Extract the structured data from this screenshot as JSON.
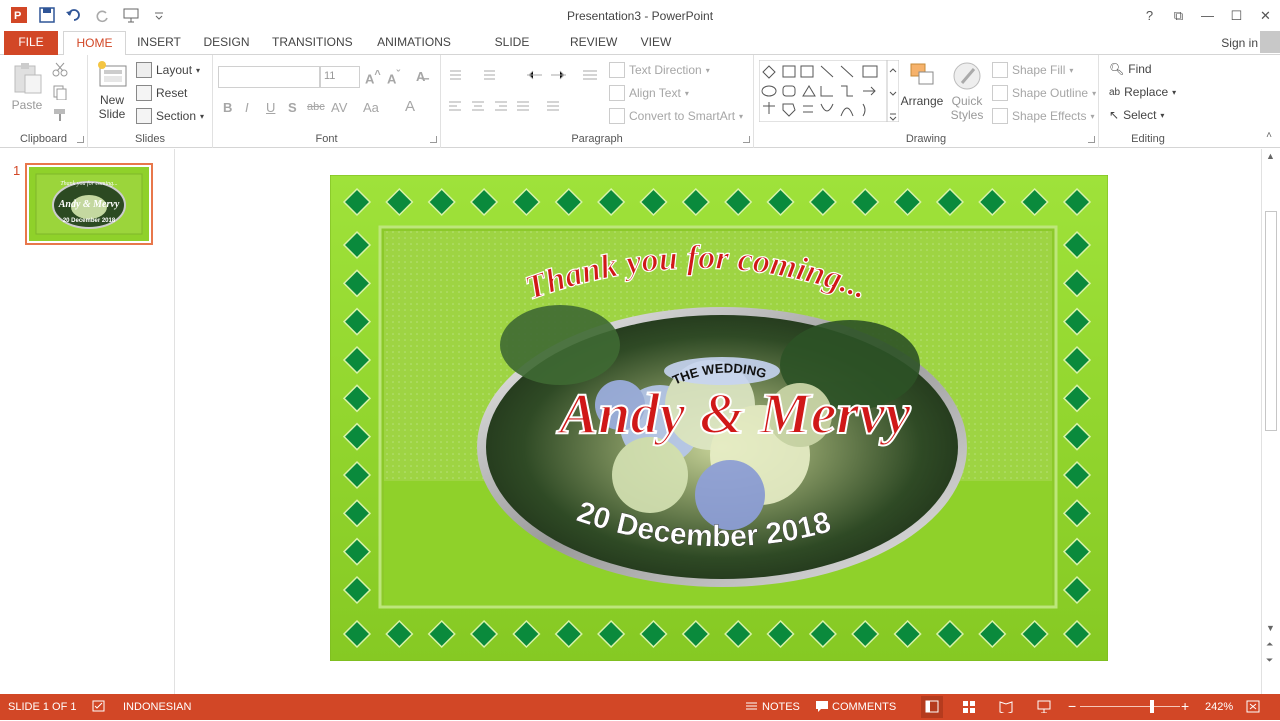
{
  "window": {
    "title": "Presentation3 - PowerPoint"
  },
  "tabs": [
    "FILE",
    "HOME",
    "INSERT",
    "DESIGN",
    "TRANSITIONS",
    "ANIMATIONS",
    "SLIDE SHOW",
    "REVIEW",
    "VIEW"
  ],
  "signin": "Sign in",
  "ribbon": {
    "clipboard": {
      "label": "Clipboard",
      "paste": "Paste"
    },
    "slides": {
      "label": "Slides",
      "new_slide_1": "New",
      "new_slide_2": "Slide",
      "layout": "Layout",
      "reset": "Reset",
      "section": "Section"
    },
    "font": {
      "label": "Font",
      "font_name": "",
      "font_size": "11"
    },
    "paragraph": {
      "label": "Paragraph",
      "text_direction": "Text Direction",
      "align_text": "Align Text",
      "convert_smartart": "Convert to SmartArt"
    },
    "drawing": {
      "label": "Drawing",
      "arrange": "Arrange",
      "quick_1": "Quick",
      "quick_2": "Styles",
      "shape_fill": "Shape Fill",
      "shape_outline": "Shape Outline",
      "shape_effects": "Shape Effects"
    },
    "editing": {
      "label": "Editing",
      "find": "Find",
      "replace": "Replace",
      "select": "Select"
    }
  },
  "slide_panel": {
    "number": "1"
  },
  "slide": {
    "thank_you": "Thank you for coming...",
    "the_wedding": "THE WEDDING",
    "names": "Andy & Mervy",
    "date": "20 December 2018"
  },
  "status": {
    "slide_of": "SLIDE 1 OF 1",
    "language": "INDONESIAN",
    "notes": "NOTES",
    "comments": "COMMENTS",
    "zoom": "242%"
  },
  "colors": {
    "accent": "#d24726",
    "slide_green": "#8fd12a",
    "diamond": "#0a8a3c"
  }
}
